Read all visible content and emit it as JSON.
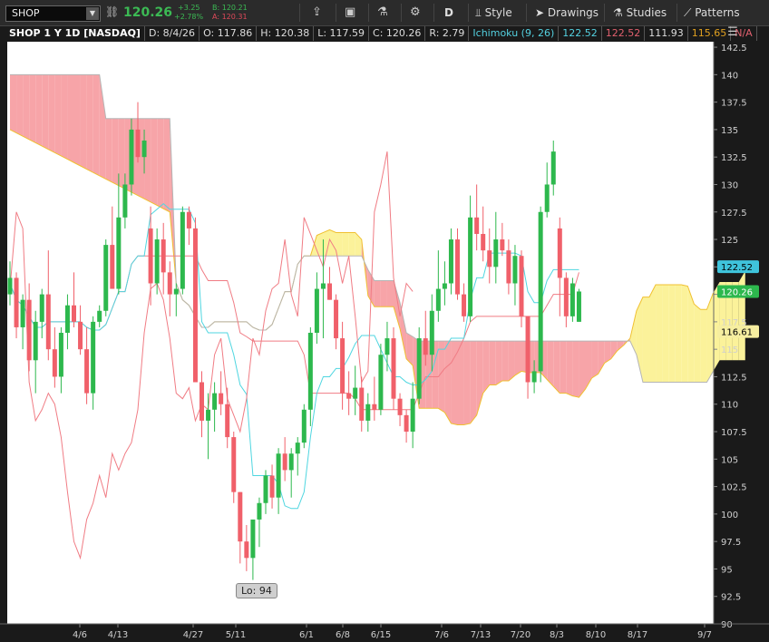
{
  "toolbar": {
    "symbol": "SHOP",
    "last_price": "120.26",
    "change_abs": "+3.25",
    "change_pct": "+2.78%",
    "bid": "B: 120.21",
    "ask": "A: 120.31",
    "buttons": [
      {
        "label": "D"
      },
      {
        "label": "Style"
      },
      {
        "label": "Drawings"
      },
      {
        "label": "Studies"
      },
      {
        "label": "Patterns"
      }
    ]
  },
  "infobar": {
    "title": "SHOP 1 Y 1D [NASDAQ]",
    "date": "D: 8/4/26",
    "open": "O: 117.86",
    "high": "H: 120.38",
    "low": "L: 117.59",
    "close": "C: 120.26",
    "range": "R: 2.79",
    "study": "Ichimoku (9, 26)",
    "v1": "122.52",
    "v2": "122.52",
    "v3": "111.93",
    "v4": "115.65",
    "v5": "N/A"
  },
  "colors": {
    "up": "#2db84d",
    "down": "#f0606a",
    "tenkan": "#4fd6e0",
    "kijun": "#f07c84",
    "chikou": "#f07c84",
    "cloud_bear": "#f7a4a8",
    "cloud_bull": "#fbf29a",
    "span_a": "#f0c030",
    "span_b": "#b5b5b5"
  },
  "lo_label": "Lo: 94",
  "chart_data": {
    "type": "candlestick",
    "ylim": [
      90,
      143
    ],
    "y_ticks": [
      "142.5",
      "140",
      "137.5",
      "135",
      "132.5",
      "130",
      "127.5",
      "125",
      "122.5",
      "120",
      "117.5",
      "115",
      "112.5",
      "110",
      "107.5",
      "105",
      "102.5",
      "100",
      "97.5",
      "95",
      "92.5",
      "90"
    ],
    "x_ticks": [
      "4/6",
      "4/13",
      "4/27",
      "5/11",
      "6/1",
      "6/8",
      "6/15",
      "7/6",
      "7/13",
      "7/20",
      "8/3",
      "8/10",
      "8/17",
      "9/7"
    ],
    "price_labels": [
      {
        "value": 122.52,
        "text": "122.52",
        "bg": "#3fc4dc",
        "fg": "#000"
      },
      {
        "value": 120.26,
        "text": "120.26",
        "bg": "#2db84d",
        "fg": "#fff"
      },
      {
        "value": 116.61,
        "text": "116.61",
        "bg": "#f6eea0",
        "fg": "#000"
      }
    ],
    "candles": [
      [
        120,
        123,
        119,
        121.5
      ],
      [
        121.5,
        122,
        116,
        117
      ],
      [
        117,
        120,
        115,
        119.5
      ],
      [
        119.5,
        121,
        113,
        114
      ],
      [
        114,
        118.5,
        111,
        117.5
      ],
      [
        117.5,
        120.5,
        116,
        120
      ],
      [
        120,
        124,
        114,
        115
      ],
      [
        115,
        117,
        111.5,
        112.5
      ],
      [
        112.5,
        117,
        111,
        116.5
      ],
      [
        116.5,
        120,
        115,
        119
      ],
      [
        119,
        122,
        117,
        117.5
      ],
      [
        117.5,
        119,
        114.5,
        115
      ],
      [
        115,
        117,
        110,
        111
      ],
      [
        111,
        118,
        109.5,
        117.5
      ],
      [
        117.5,
        119,
        117,
        118.5
      ],
      [
        118.5,
        125,
        118,
        124.5
      ],
      [
        124.5,
        128,
        121,
        120.5
      ],
      [
        120.5,
        131,
        120,
        127
      ],
      [
        127,
        131,
        126,
        130
      ],
      [
        130,
        136,
        129,
        135
      ],
      [
        135,
        137.5,
        132,
        132.5
      ],
      [
        132.5,
        135,
        131,
        134
      ],
      [
        126,
        128,
        119,
        121
      ],
      [
        121,
        126,
        120,
        125
      ],
      [
        125,
        126.5,
        120,
        122
      ],
      [
        122,
        123,
        118,
        120
      ],
      [
        120,
        121,
        118,
        120.5
      ],
      [
        120.5,
        128,
        120,
        127.5
      ],
      [
        127.5,
        128,
        124.5,
        126
      ],
      [
        126,
        127,
        120,
        112
      ],
      [
        112,
        113,
        107,
        108.5
      ],
      [
        108.5,
        111,
        105,
        109.5
      ],
      [
        109.5,
        112,
        107.5,
        111
      ],
      [
        111,
        113,
        109,
        110
      ],
      [
        110,
        111.5,
        106,
        107
      ],
      [
        107,
        107.5,
        101,
        102
      ],
      [
        102,
        102,
        95.5,
        97.5
      ],
      [
        97.5,
        99,
        94.8,
        96
      ],
      [
        96,
        98.5,
        94,
        99.5
      ],
      [
        99.5,
        101.5,
        97,
        101
      ],
      [
        101,
        104,
        100,
        103.5
      ],
      [
        103.5,
        104.5,
        100.5,
        101.5
      ],
      [
        101.5,
        106,
        100,
        105.5
      ],
      [
        105.5,
        107,
        103,
        104
      ],
      [
        104,
        106,
        101.5,
        105.5
      ],
      [
        105.5,
        107,
        103.5,
        106.5
      ],
      [
        106.5,
        110,
        106,
        109.5
      ],
      [
        109.5,
        117,
        108,
        116.5
      ],
      [
        116.5,
        122,
        115.5,
        120.5
      ],
      [
        120.5,
        125,
        116,
        121
      ],
      [
        121,
        122.5,
        119.5,
        119.5
      ],
      [
        119.5,
        120,
        115,
        116
      ],
      [
        116,
        117.5,
        109.5,
        111
      ],
      [
        111,
        113,
        109,
        110.5
      ],
      [
        110.5,
        113.5,
        109,
        111.5
      ],
      [
        111.5,
        112.5,
        107.5,
        108.5
      ],
      [
        108.5,
        111,
        107.5,
        110
      ],
      [
        110,
        112.5,
        108.5,
        109.5
      ],
      [
        109.5,
        115.5,
        109,
        114.5
      ],
      [
        114.5,
        117.5,
        113,
        116
      ],
      [
        116,
        117,
        109.5,
        110.5
      ],
      [
        110.5,
        111,
        108,
        109
      ],
      [
        109,
        109.5,
        106.5,
        107.5
      ],
      [
        107.5,
        112,
        106,
        110.5
      ],
      [
        110.5,
        117,
        110,
        116
      ],
      [
        116,
        118.5,
        113.5,
        114.5
      ],
      [
        114.5,
        120,
        113,
        118.5
      ],
      [
        118.5,
        124,
        117.5,
        120.5
      ],
      [
        120.5,
        123,
        119,
        121
      ],
      [
        121,
        126,
        120,
        125
      ],
      [
        125,
        126,
        119.5,
        120
      ],
      [
        120,
        121,
        117.5,
        118
      ],
      [
        118,
        129,
        117.5,
        127
      ],
      [
        127,
        130,
        124,
        125.5
      ],
      [
        125.5,
        128,
        123,
        124
      ],
      [
        124,
        126,
        121,
        122.5
      ],
      [
        122.5,
        127.5,
        121,
        125
      ],
      [
        125,
        126.5,
        123.5,
        124
      ],
      [
        124,
        125,
        120,
        121
      ],
      [
        121,
        124.5,
        119,
        123.5
      ],
      [
        123.5,
        124,
        117,
        118
      ],
      [
        118,
        115,
        110.5,
        112
      ],
      [
        112,
        114,
        111,
        113
      ],
      [
        113,
        128,
        112,
        127.5
      ],
      [
        127.5,
        132,
        127,
        130
      ],
      [
        130,
        134,
        129,
        133
      ],
      [
        126,
        127,
        118,
        121.5
      ],
      [
        121.5,
        122,
        117,
        118
      ],
      [
        118,
        121.5,
        117.5,
        121
      ],
      [
        117.5,
        120.5,
        117.5,
        120.26
      ]
    ]
  }
}
